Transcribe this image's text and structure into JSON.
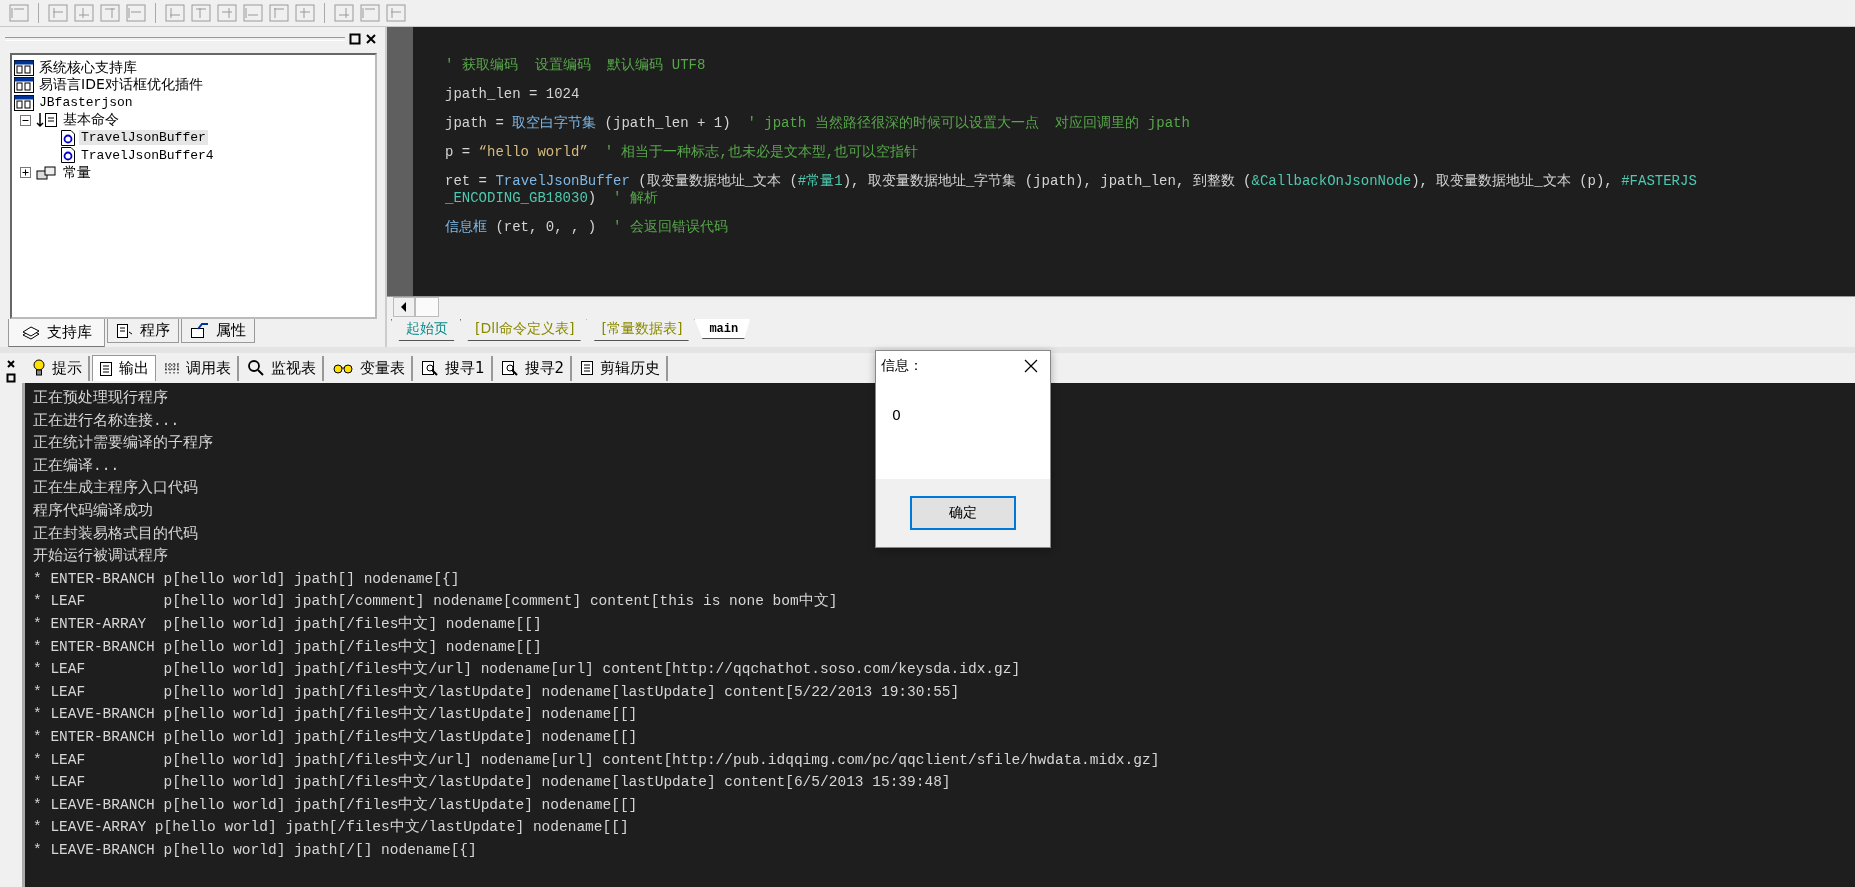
{
  "tree": [
    {
      "label": "系统核心支持库",
      "kind": "library",
      "selected": false
    },
    {
      "label": "易语言IDE对话框优化插件",
      "kind": "library",
      "selected": false
    },
    {
      "label": "JBfasterjson",
      "kind": "library",
      "selected": false,
      "children": [
        {
          "label": "基本命令",
          "kind": "module",
          "selected": false,
          "expanded": true,
          "children": [
            {
              "label": "TravelJsonBuffer",
              "kind": "method",
              "selected": true
            },
            {
              "label": "TravelJsonBuffer4",
              "kind": "method",
              "selected": false
            }
          ]
        },
        {
          "label": "常量",
          "kind": "constants",
          "selected": false,
          "expanded": false
        }
      ]
    }
  ],
  "left_tabs": [
    {
      "label": "支持库",
      "kind": "books",
      "selected": true
    },
    {
      "label": "程序",
      "kind": "doc",
      "selected": false
    },
    {
      "label": "属性",
      "kind": "props",
      "selected": false
    }
  ],
  "code_lines": [
    {
      "rows": [
        [
          {
            "kind": "comment",
            "text": "' 获取编码  设置编码  默认编码 UTF8"
          }
        ]
      ]
    },
    {
      "rows": [
        [
          {
            "kind": "plain",
            "text": "jpath_len = 1024"
          }
        ]
      ]
    },
    {
      "rows": [
        [
          {
            "kind": "plain",
            "text": "jpath = "
          },
          {
            "kind": "func",
            "text": "取空白字节集"
          },
          {
            "kind": "plain",
            "text": " (jpath_len + 1)  "
          },
          {
            "kind": "comment",
            "text": "' jpath 当然路径很深的时候可以设置大一点  对应回调里的 jpath"
          }
        ]
      ]
    },
    {
      "rows": [
        [
          {
            "kind": "plain",
            "text": "p = "
          },
          {
            "kind": "string",
            "text": "“hello world”"
          },
          {
            "kind": "plain",
            "text": "  "
          },
          {
            "kind": "comment",
            "text": "' 相当于一种标志,也未必是文本型,也可以空指针"
          }
        ]
      ]
    },
    {
      "rows": [
        [
          {
            "kind": "plain",
            "text": "ret = "
          },
          {
            "kind": "func",
            "text": "TravelJsonBuffer"
          },
          {
            "kind": "plain",
            "text": " (取变量数据地址_文本 ("
          },
          {
            "kind": "const",
            "text": "#常量1"
          },
          {
            "kind": "plain",
            "text": "), 取变量数据地址_字节集 (jpath), jpath_len, 到整数 ("
          },
          {
            "kind": "const",
            "text": "&CallbackOnJsonNode"
          },
          {
            "kind": "plain",
            "text": "), 取变量数据地址_文本 (p), "
          },
          {
            "kind": "const",
            "text": "#FASTERJS"
          }
        ],
        [
          {
            "kind": "const",
            "text": "_ENCODING_GB18030"
          },
          {
            "kind": "plain",
            "text": ")  "
          },
          {
            "kind": "comment",
            "text": "' 解析"
          }
        ]
      ]
    },
    {
      "rows": [
        [
          {
            "kind": "func",
            "text": "信息框"
          },
          {
            "kind": "plain",
            "text": " (ret, 0, , )  "
          },
          {
            "kind": "comment",
            "text": "' 会返回错误代码"
          }
        ]
      ]
    }
  ],
  "file_tabs": [
    {
      "label": "起始页",
      "color": "#0a8a8a",
      "selected": false
    },
    {
      "label": "[Dll命令定义表]",
      "color": "#8a8a00",
      "selected": false
    },
    {
      "label": "[常量数据表]",
      "color": "#8a8a00",
      "selected": false
    },
    {
      "label": "main",
      "color": "#000000",
      "selected": true
    }
  ],
  "output_tabs": [
    {
      "label": "提示",
      "kind": "bulb",
      "selected": false
    },
    {
      "label": "输出",
      "kind": "doc",
      "selected": true
    },
    {
      "label": "调用表",
      "kind": "grid",
      "selected": false
    },
    {
      "label": "监视表",
      "kind": "search",
      "selected": false
    },
    {
      "label": "变量表",
      "kind": "glasses",
      "selected": false
    },
    {
      "label": "搜寻1",
      "kind": "find",
      "selected": false
    },
    {
      "label": "搜寻2",
      "kind": "find",
      "selected": false
    },
    {
      "label": "剪辑历史",
      "kind": "doc",
      "selected": false
    }
  ],
  "output_lines": [
    "正在预处理现行程序",
    "正在进行名称连接...",
    "正在统计需要编译的子程序",
    "正在编译...",
    "正在生成主程序入口代码",
    "程序代码编译成功",
    "正在封装易格式目的代码",
    "开始运行被调试程序",
    "* ENTER-BRANCH p[hello world] jpath[] nodename[{]",
    "* LEAF         p[hello world] jpath[/comment] nodename[comment] content[this is none bom中文]",
    "* ENTER-ARRAY  p[hello world] jpath[/files中文] nodename[[]",
    "* ENTER-BRANCH p[hello world] jpath[/files中文] nodename[[]",
    "* LEAF         p[hello world] jpath[/files中文/url] nodename[url] content[http://qqchathot.soso.com/keysda.idx.gz]",
    "* LEAF         p[hello world] jpath[/files中文/lastUpdate] nodename[lastUpdate] content[5/22/2013 19:30:55]",
    "* LEAVE-BRANCH p[hello world] jpath[/files中文/lastUpdate] nodename[[]",
    "* ENTER-BRANCH p[hello world] jpath[/files中文/lastUpdate] nodename[[]",
    "* LEAF         p[hello world] jpath[/files中文/url] nodename[url] content[http://pub.idqqimg.com/pc/qqclient/sfile/hwdata.midx.gz]",
    "* LEAF         p[hello world] jpath[/files中文/lastUpdate] nodename[lastUpdate] content[6/5/2013 15:39:48]",
    "* LEAVE-BRANCH p[hello world] jpath[/files中文/lastUpdate] nodename[[]",
    "* LEAVE-ARRAY p[hello world] jpath[/files中文/lastUpdate] nodename[[]",
    "* LEAVE-BRANCH p[hello world] jpath[/[] nodename[{]"
  ],
  "dialog": {
    "title": "信息：",
    "message": "0",
    "button": "确定"
  }
}
